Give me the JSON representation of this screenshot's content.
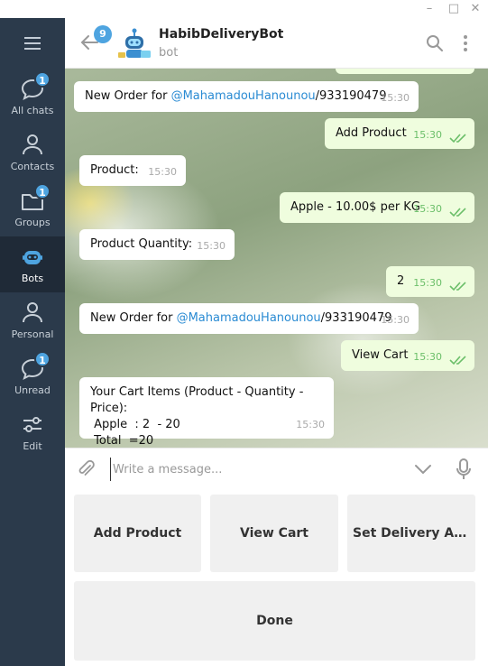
{
  "window": {
    "minimize_label": "–",
    "maximize_label": "□",
    "close_label": "✕"
  },
  "sidebar": {
    "items": [
      {
        "label": "All chats",
        "badge": "1",
        "icon": "chat-bubble-icon"
      },
      {
        "label": "Contacts",
        "badge": "",
        "icon": "person-icon"
      },
      {
        "label": "Groups",
        "badge": "1",
        "icon": "folder-icon"
      },
      {
        "label": "Bots",
        "badge": "",
        "icon": "bot-icon",
        "active": true
      },
      {
        "label": "Personal",
        "badge": "",
        "icon": "person-icon"
      },
      {
        "label": "Unread",
        "badge": "1",
        "icon": "chat-bubble-icon"
      },
      {
        "label": "Edit",
        "badge": "",
        "icon": "sliders-icon"
      }
    ]
  },
  "header": {
    "unread_count": "9",
    "title": "HabibDeliveryBot",
    "subtitle": "bot"
  },
  "messages": [
    {
      "dir": "in",
      "prefix": "New Order for ",
      "link": "@MahamadouHanounou",
      "suffix": "/933190479",
      "time": "15:30"
    },
    {
      "dir": "out",
      "text": "Add Product",
      "time": "15:30"
    },
    {
      "dir": "in",
      "text": "Product:",
      "time": "15:30"
    },
    {
      "dir": "out",
      "text": "Apple - 10.00$ per KG",
      "time": "15:30"
    },
    {
      "dir": "in",
      "text": "Product Quantity:",
      "time": "15:30"
    },
    {
      "dir": "out",
      "text": "2",
      "time": "15:30"
    },
    {
      "dir": "in",
      "prefix": "New Order for ",
      "link": "@MahamadouHanounou",
      "suffix": "/933190479",
      "time": "15:30"
    },
    {
      "dir": "out",
      "text": "View Cart",
      "time": "15:30"
    },
    {
      "dir": "in",
      "lines": [
        "Your Cart Items (Product - Quantity - Price):",
        " Apple  : 2  - 20",
        " Total  =20"
      ],
      "time": "15:30"
    }
  ],
  "input": {
    "placeholder": "Write a message..."
  },
  "keyboard": {
    "buttons": [
      "Add Product",
      "View Cart",
      "Set Delivery Ad...",
      "Done"
    ]
  },
  "colors": {
    "sidebar_bg": "#2b3a4b",
    "sidebar_active_bg": "#1f2a37",
    "badge": "#4ea4e0",
    "outgoing_bubble": "#effdde",
    "incoming_bubble": "#ffffff",
    "link": "#2a8bd3",
    "check": "#6cbf6a"
  }
}
